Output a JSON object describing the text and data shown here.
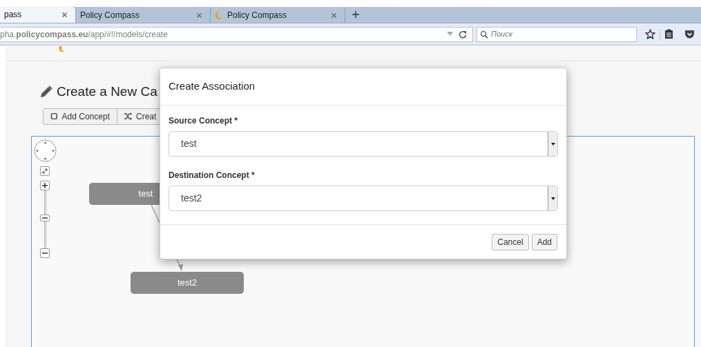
{
  "browser": {
    "tabs": [
      {
        "title": "pass",
        "selected": true,
        "favicon": false
      },
      {
        "title": "Policy Compass",
        "selected": false,
        "favicon": false
      },
      {
        "title": "Policy Compass",
        "selected": false,
        "favicon": true
      }
    ],
    "url": "pha.**policycompass.eu**/app/#!/models/create",
    "search_placeholder": "Поиск"
  },
  "page": {
    "heading": "Create a New Ca",
    "toolbar": [
      {
        "label": "Add Concept",
        "kind": "concept"
      },
      {
        "label": "Creat",
        "kind": "association"
      }
    ],
    "nodes": [
      {
        "label": "test"
      },
      {
        "label": "test2"
      }
    ]
  },
  "dialog": {
    "title": "Create Association",
    "fields": [
      {
        "label": "Source Concept *",
        "value": "test"
      },
      {
        "label": "Destination Concept *",
        "value": "test2"
      }
    ],
    "buttons": [
      "Cancel",
      "Add"
    ]
  }
}
